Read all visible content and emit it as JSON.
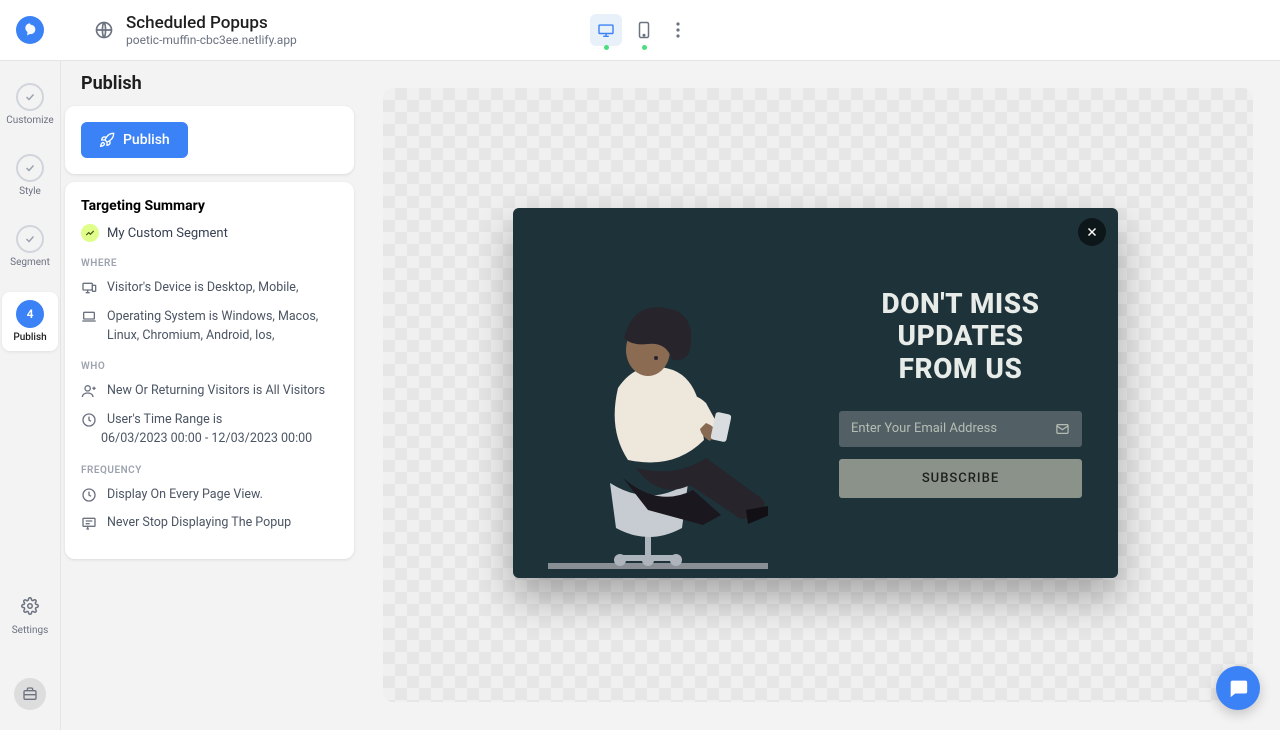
{
  "header": {
    "title": "Scheduled Popups",
    "domain": "poetic-muffin-cbc3ee.netlify.app"
  },
  "rail": {
    "steps": [
      {
        "label": "Customize"
      },
      {
        "label": "Style"
      },
      {
        "label": "Segment"
      },
      {
        "label": "Publish",
        "number": "4"
      }
    ],
    "settings_label": "Settings"
  },
  "panel": {
    "title": "Publish",
    "publish_button": "Publish",
    "targeting_title": "Targeting Summary",
    "segment_name": "My Custom Segment",
    "sections": {
      "where_label": "WHERE",
      "where": [
        "Visitor's Device is Desktop, Mobile,",
        "Operating System is Windows, Macos, Linux, Chromium, Android, Ios,"
      ],
      "who_label": "WHO",
      "who": [
        "New Or Returning Visitors is All Visitors",
        "User's Time Range is",
        "06/03/2023 00:00 - 12/03/2023 00:00"
      ],
      "frequency_label": "FREQUENCY",
      "frequency": [
        "Display On Every Page View.",
        "Never Stop Displaying The Popup"
      ]
    }
  },
  "popup": {
    "heading_l1": "DON'T MISS",
    "heading_l2": "UPDATES",
    "heading_l3": "FROM US",
    "email_placeholder": "Enter Your Email Address",
    "subscribe": "SUBSCRIBE"
  }
}
